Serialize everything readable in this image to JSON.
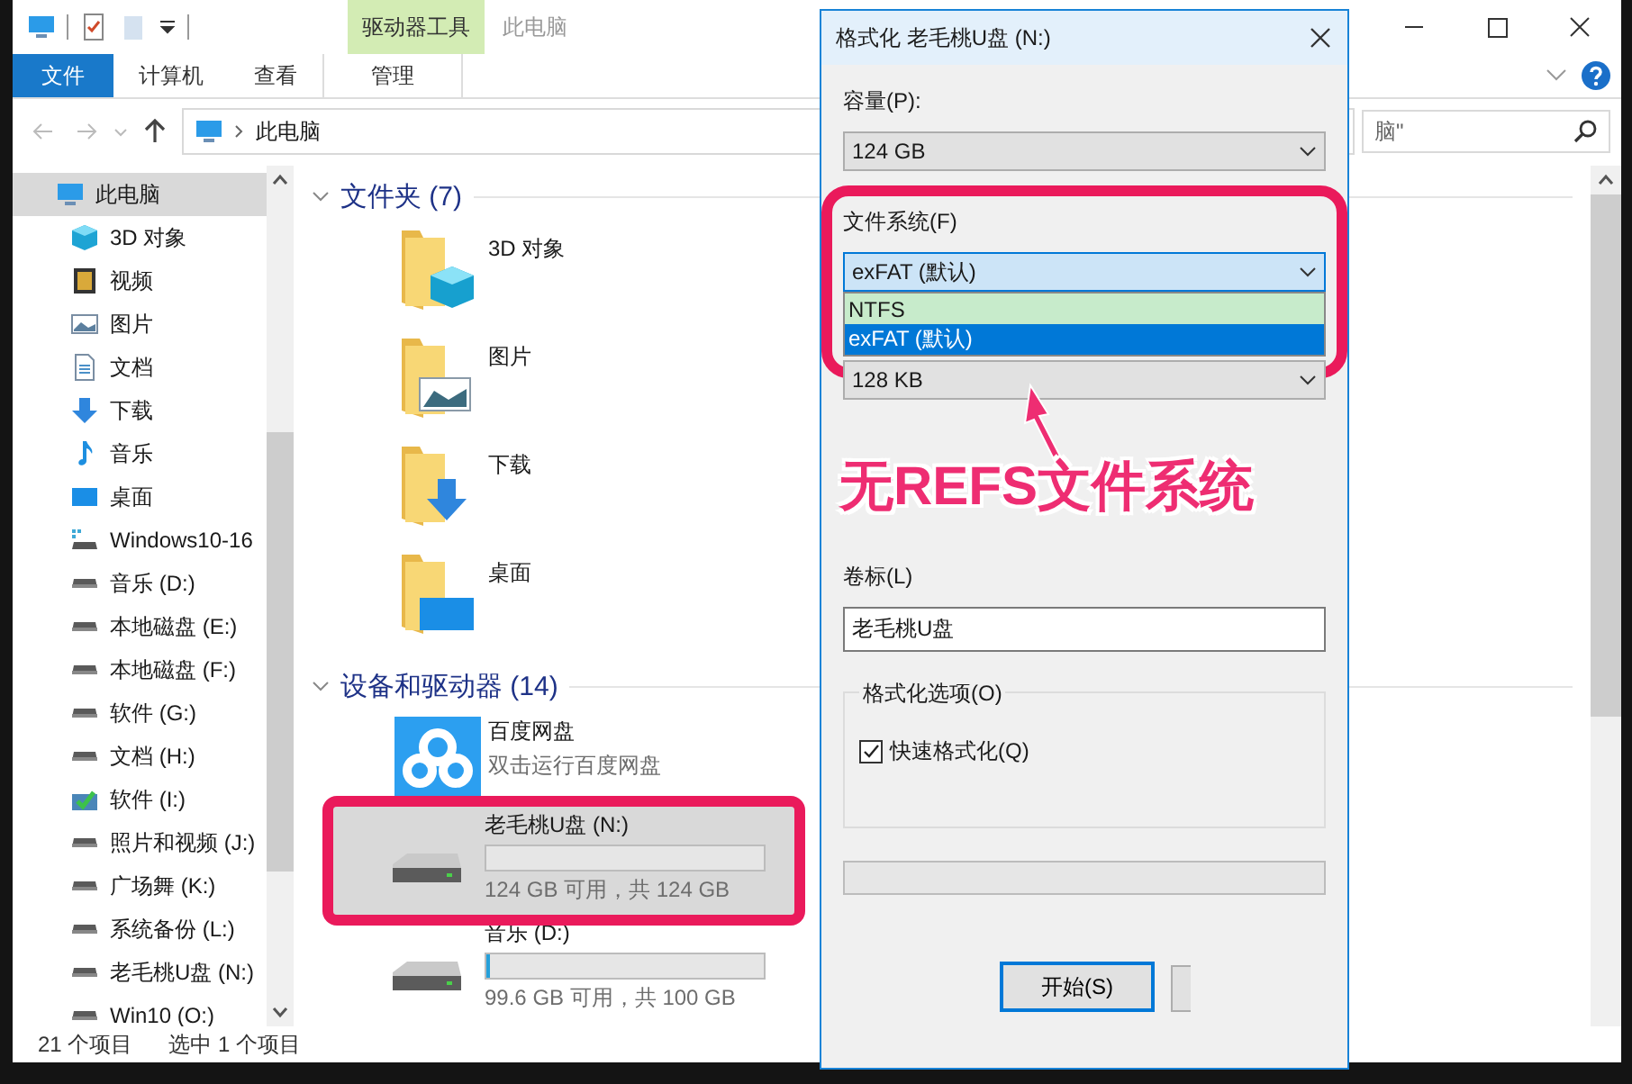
{
  "explorer": {
    "title": "此电脑",
    "context_group": "驱动器工具",
    "ribbon_tabs": [
      {
        "label": "文件",
        "kind": "file"
      },
      {
        "label": "计算机",
        "kind": "plain"
      },
      {
        "label": "查看",
        "kind": "plain"
      },
      {
        "label": "管理",
        "kind": "context"
      }
    ],
    "address": {
      "path": "此电脑"
    },
    "search": {
      "placeholder": "脑\""
    },
    "nav": [
      {
        "label": "此电脑",
        "kind": "pc",
        "selected": true,
        "children": [
          {
            "label": "3D 对象",
            "kind": "cube",
            "selected": false
          },
          {
            "label": "视频",
            "kind": "film",
            "selected": false
          },
          {
            "label": "图片",
            "kind": "image",
            "selected": false
          },
          {
            "label": "文档",
            "kind": "doc",
            "selected": false
          },
          {
            "label": "下载",
            "kind": "download",
            "selected": false
          },
          {
            "label": "音乐",
            "kind": "music",
            "selected": false
          },
          {
            "label": "桌面",
            "kind": "desktop",
            "selected": false
          },
          {
            "label": "Windows10-16",
            "kind": "netdrive",
            "selected": false
          },
          {
            "label": "音乐 (D:)",
            "kind": "drive",
            "selected": false
          },
          {
            "label": "本地磁盘 (E:)",
            "kind": "drive",
            "selected": false
          },
          {
            "label": "本地磁盘 (F:)",
            "kind": "drive",
            "selected": false
          },
          {
            "label": "软件 (G:)",
            "kind": "drive",
            "selected": false
          },
          {
            "label": "文档 (H:)",
            "kind": "drive",
            "selected": false
          },
          {
            "label": "软件  (I:)",
            "kind": "drivecheck",
            "selected": false
          },
          {
            "label": "照片和视频 (J:)",
            "kind": "drive",
            "selected": false
          },
          {
            "label": "广场舞 (K:)",
            "kind": "drive",
            "selected": false
          },
          {
            "label": "系统备份 (L:)",
            "kind": "drive",
            "selected": false
          },
          {
            "label": "老毛桃U盘 (N:)",
            "kind": "drive",
            "selected": false
          },
          {
            "label": "Win10 (O:)",
            "kind": "drive",
            "selected": false
          }
        ]
      }
    ],
    "groups": [
      {
        "title": "文件夹 (7)",
        "expanded": true,
        "items": [
          {
            "name": "3D 对象",
            "kind": "folder3d"
          },
          {
            "name": "图片",
            "kind": "folderpictures"
          },
          {
            "name": "下载",
            "kind": "folderdownloads"
          },
          {
            "name": "桌面",
            "kind": "folderdesktop"
          }
        ]
      },
      {
        "title": "设备和驱动器 (14)",
        "expanded": true,
        "items": [
          {
            "name": "百度网盘",
            "kind": "app",
            "subtitle": "双击运行百度网盘"
          },
          {
            "name": "老毛桃U盘 (N:)",
            "kind": "drive",
            "level": 0,
            "info": "124 GB 可用，共 124 GB",
            "selected": true,
            "highlighted": true
          },
          {
            "name": "音乐 (D:)",
            "kind": "drive",
            "level": 0.01,
            "info": "99.6 GB 可用，共 100 GB",
            "selected": false,
            "highlighted": false
          }
        ]
      }
    ],
    "status": {
      "count": "21 个项目",
      "selection": "选中 1 个项目"
    }
  },
  "dialog": {
    "title": "格式化 老毛桃U盘 (N:)",
    "capacity": {
      "label": "容量(P):",
      "value": "124 GB"
    },
    "filesystem": {
      "label": "文件系统(F)",
      "value": "exFAT (默认)",
      "expanded": true,
      "highlighted": true,
      "options": [
        {
          "label": "NTFS",
          "selected": false,
          "hovered": true
        },
        {
          "label": "exFAT (默认)",
          "selected": true,
          "hovered": false
        }
      ]
    },
    "allocation": {
      "value": "128 KB"
    },
    "volume": {
      "label": "卷标(L)",
      "value": "老毛桃U盘"
    },
    "options_group": {
      "title": "格式化选项(O)",
      "quick_format": {
        "label": "快速格式化(Q)",
        "checked": true
      }
    },
    "progress": {
      "level": 0
    },
    "start_button": "开始(S)"
  },
  "annotation": {
    "text": "无REFS文件系统"
  }
}
